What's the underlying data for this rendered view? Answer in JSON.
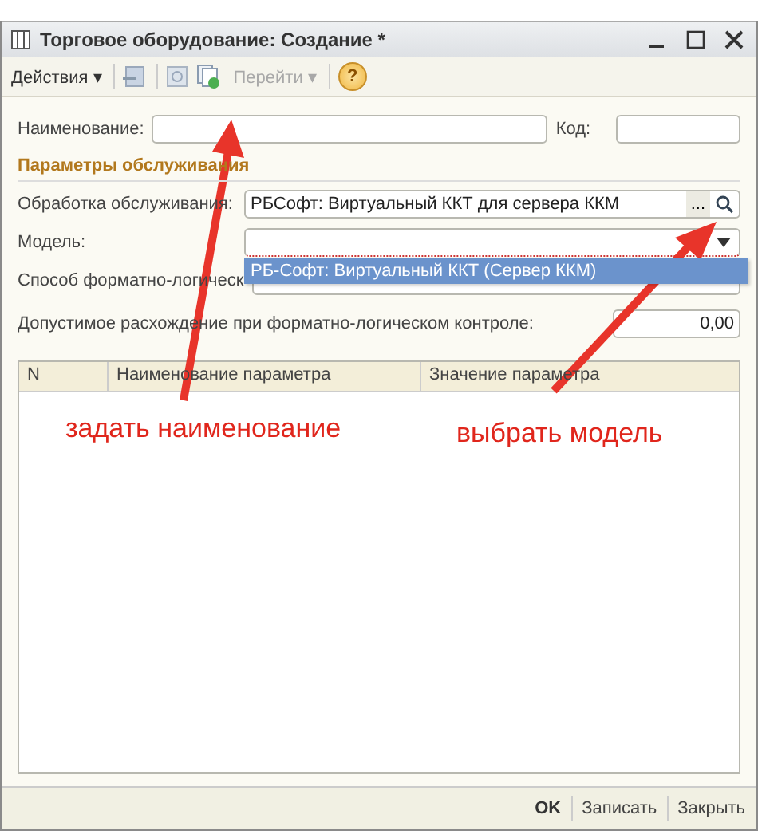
{
  "window": {
    "title": "Торговое оборудование: Создание *"
  },
  "toolbar": {
    "actions_menu": "Действия",
    "menu_caret": "▾",
    "goto_menu": {
      "label": "Перейти",
      "disabled": true
    },
    "help": "?"
  },
  "name_field": {
    "label": "Наименование:"
  },
  "code_field": {
    "label": "Код:"
  },
  "section_title": "Параметры обслуживания",
  "processing_field": {
    "label": "Обработка обслуживания:",
    "value": "РБСофт: Виртуальный ККТ для сервера ККМ",
    "select_button": "..."
  },
  "model_field": {
    "label": "Модель:"
  },
  "model_dropdown": [
    {
      "label": "РБ-Софт: Виртуальный ККТ (Сервер ККМ)",
      "selected": true
    }
  ],
  "method_label": "Способ форматно-логическ",
  "tolerance_field": {
    "label": "Допустимое расхождение при форматно-логическом контроле:",
    "value": "0,00"
  },
  "table": {
    "columns": [
      "N",
      "Наименование параметра",
      "Значение параметра"
    ]
  },
  "annotations": [
    {
      "text": "задать наименование"
    },
    {
      "text": "выбрать модель"
    }
  ],
  "footer_buttons": [
    {
      "label": "OK",
      "default": true
    },
    {
      "label": "Записать",
      "default": false
    },
    {
      "label": "Закрыть",
      "default": false
    }
  ]
}
